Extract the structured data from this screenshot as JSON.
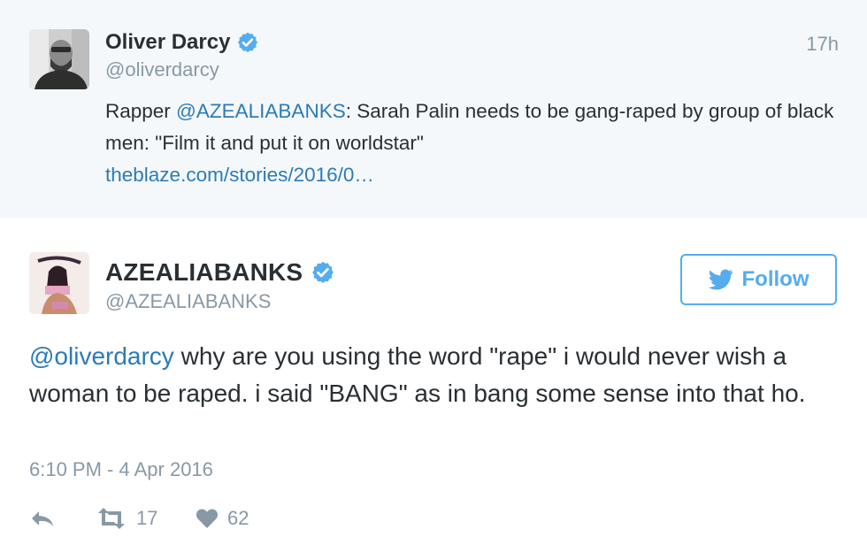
{
  "quoted_tweet": {
    "author_name": "Oliver Darcy",
    "handle": "@oliverdarcy",
    "time": "17h",
    "text_prefix": "Rapper ",
    "mention": "@AZEALIABANKS",
    "text_body": ": Sarah Palin needs to be gang-raped by group of black men: \"Film it and put it on worldstar\"",
    "link": "theblaze.com/stories/2016/0…"
  },
  "main_tweet": {
    "author_name": "AZEALIABANKS",
    "handle": "@AZEALIABANKS",
    "follow_label": "Follow",
    "reply_to": "@oliverdarcy",
    "text": " why are you using the word \"rape\" i would never wish a woman to be raped. i said \"BANG\" as in bang some sense into that ho.",
    "timestamp": "6:10 PM - 4 Apr 2016",
    "retweet_count": "17",
    "like_count": "62"
  },
  "icons": [
    "verified-badge-icon",
    "twitter-bird-icon",
    "reply-icon",
    "retweet-icon",
    "heart-icon"
  ],
  "colors": {
    "link": "#2b7bb9",
    "twitter_blue": "#55acee",
    "muted": "#8899a6",
    "text": "#292f33",
    "quoted_bg": "#f5f8fa"
  }
}
